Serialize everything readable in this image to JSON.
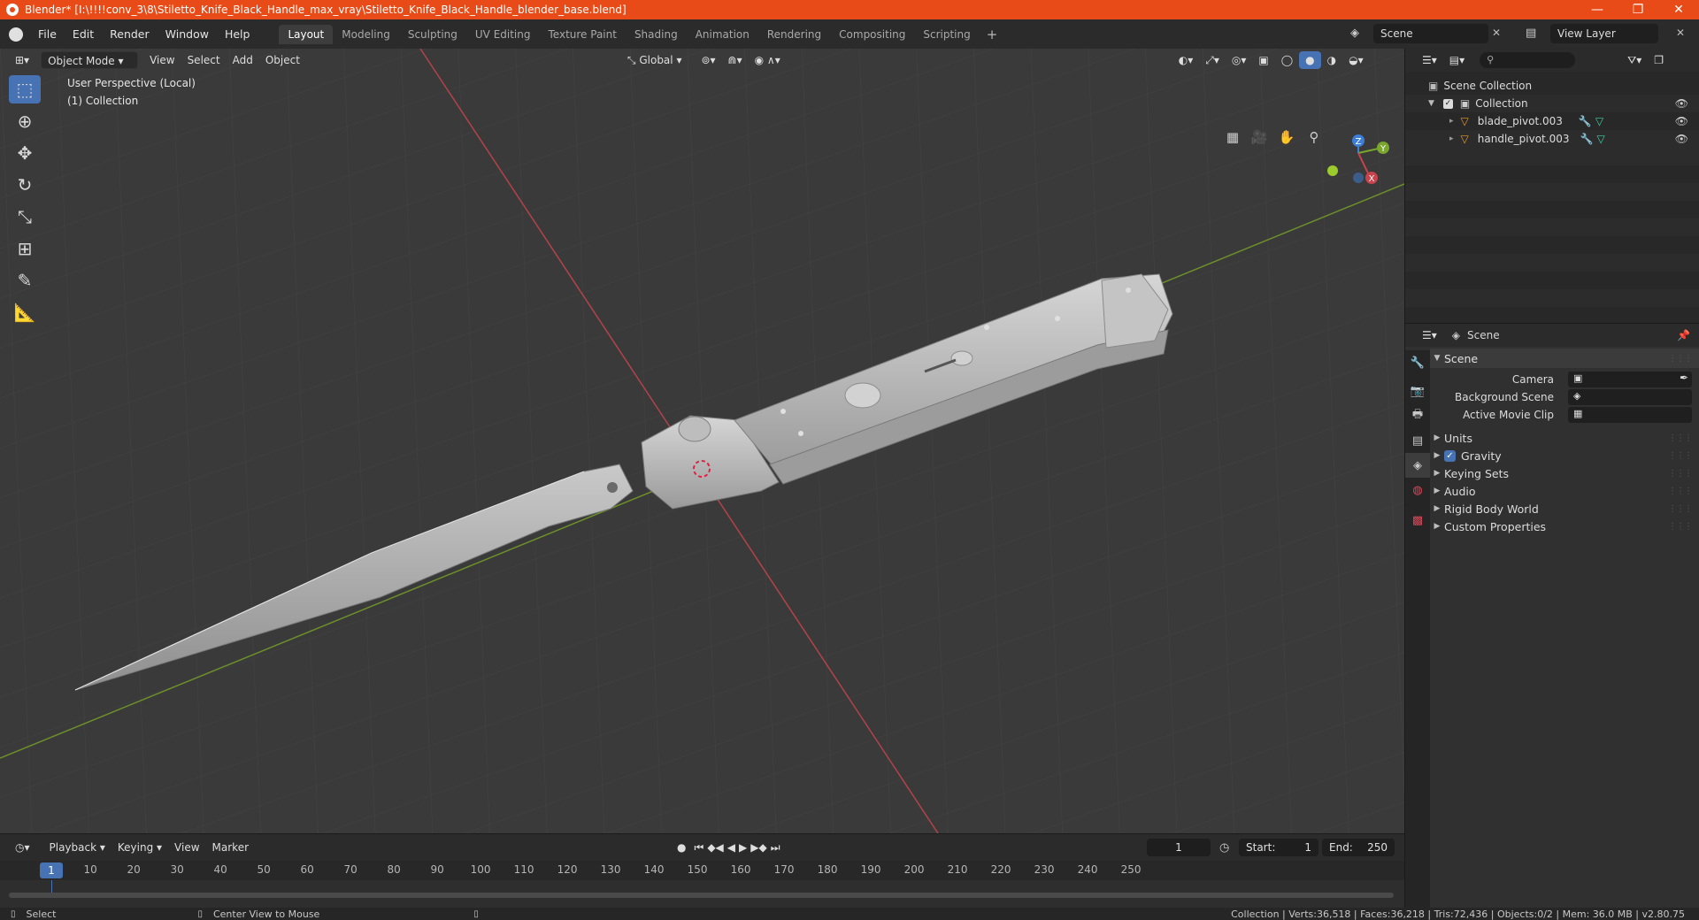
{
  "window": {
    "title": "Blender* [I:\\!!!!conv_3\\8\\Stiletto_Knife_Black_Handle_max_vray\\Stiletto_Knife_Black_Handle_blender_base.blend]",
    "minimize": "—",
    "maximize": "❐",
    "close": "✕"
  },
  "menus": [
    "File",
    "Edit",
    "Render",
    "Window",
    "Help"
  ],
  "workspaces": [
    "Layout",
    "Modeling",
    "Sculpting",
    "UV Editing",
    "Texture Paint",
    "Shading",
    "Animation",
    "Rendering",
    "Compositing",
    "Scripting"
  ],
  "workspace_add": "+",
  "scene_selector": "Scene",
  "view_layer": "View Layer",
  "viewport": {
    "mode": "Object Mode",
    "menus": [
      "View",
      "Select",
      "Add",
      "Object"
    ],
    "orientation": "Global",
    "info_line1": "User Perspective (Local)",
    "info_line2": "(1) Collection",
    "gizmo": {
      "z": "Z",
      "y": "Y",
      "x": "X"
    }
  },
  "timeline": {
    "menus": [
      "Playback",
      "Keying",
      "View",
      "Marker"
    ],
    "current_frame": "1",
    "start_label": "Start:",
    "start_value": "1",
    "end_label": "End:",
    "end_value": "250",
    "ticks": [
      "10",
      "20",
      "30",
      "40",
      "50",
      "60",
      "70",
      "80",
      "90",
      "100",
      "110",
      "120",
      "130",
      "140",
      "150",
      "160",
      "170",
      "180",
      "190",
      "200",
      "210",
      "220",
      "230",
      "240",
      "250"
    ],
    "playhead": "1"
  },
  "statusbar": {
    "select": "Select",
    "center": "Center View to Mouse",
    "stats": "Collection | Verts:36,518 | Faces:36,218 | Tris:72,436 | Objects:0/2 | Mem: 36.0 MB | v2.80.75"
  },
  "outliner": {
    "root": "Scene Collection",
    "collection": "Collection",
    "objects": [
      "blade_pivot.003",
      "handle_pivot.003"
    ]
  },
  "properties": {
    "context": "Scene",
    "panel": "Scene",
    "camera_label": "Camera",
    "background_scene_label": "Background Scene",
    "active_movie_clip_label": "Active Movie Clip",
    "subpanels": [
      "Units",
      "Gravity",
      "Keying Sets",
      "Audio",
      "Rigid Body World",
      "Custom Properties"
    ]
  },
  "colors": {
    "accent": "#4772b3",
    "titlebar": "#e84b17",
    "x_axis": "#c9434c",
    "y_axis": "#7aa62e",
    "z_axis": "#3d7fd6",
    "object_icon": "#e59a2c"
  }
}
